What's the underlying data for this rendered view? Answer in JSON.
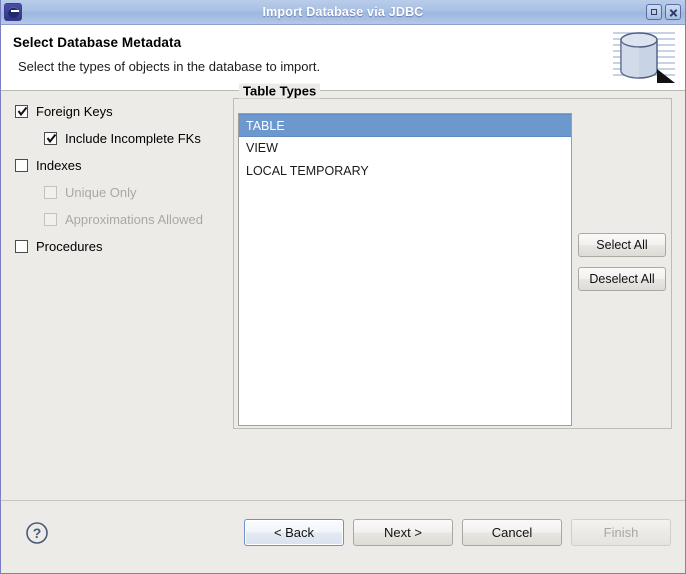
{
  "window": {
    "title": "Import Database via JDBC",
    "icon": "eclipse-app-icon",
    "buttons": {
      "maximize": "maximize-icon",
      "close": "close-icon"
    }
  },
  "header": {
    "title": "Select Database Metadata",
    "description": "Select the types of objects in the database to import.",
    "banner_icon": "database-cylinder-icon"
  },
  "options": [
    {
      "label": "Foreign Keys",
      "checked": true,
      "enabled": true,
      "indent": false,
      "name": "checkbox-foreign-keys"
    },
    {
      "label": "Include Incomplete FKs",
      "checked": true,
      "enabled": true,
      "indent": true,
      "name": "checkbox-include-incomplete-fks"
    },
    {
      "label": "Indexes",
      "checked": false,
      "enabled": true,
      "indent": false,
      "name": "checkbox-indexes"
    },
    {
      "label": "Unique Only",
      "checked": false,
      "enabled": false,
      "indent": true,
      "name": "checkbox-unique-only"
    },
    {
      "label": "Approximations Allowed",
      "checked": false,
      "enabled": false,
      "indent": true,
      "name": "checkbox-approximations-allowed"
    },
    {
      "label": "Procedures",
      "checked": false,
      "enabled": true,
      "indent": false,
      "name": "checkbox-procedures"
    }
  ],
  "table_types": {
    "group_label": "Table Types",
    "items": [
      {
        "label": "TABLE",
        "selected": true
      },
      {
        "label": "VIEW",
        "selected": false
      },
      {
        "label": "LOCAL TEMPORARY",
        "selected": false
      }
    ],
    "select_all_label": "Select All",
    "deselect_all_label": "Deselect All"
  },
  "footer": {
    "help_icon": "help-question-icon",
    "back_label": "< Back",
    "next_label": "Next >",
    "cancel_label": "Cancel",
    "finish_label": "Finish"
  },
  "colors": {
    "titlebar_top": "#b9cdea",
    "titlebar_bottom": "#b4c8e8",
    "selection_blue": "#6d98cd",
    "dialog_bg": "#ecebe8",
    "header_bg": "#ffffff",
    "disabled_text": "#a9a9a4"
  }
}
